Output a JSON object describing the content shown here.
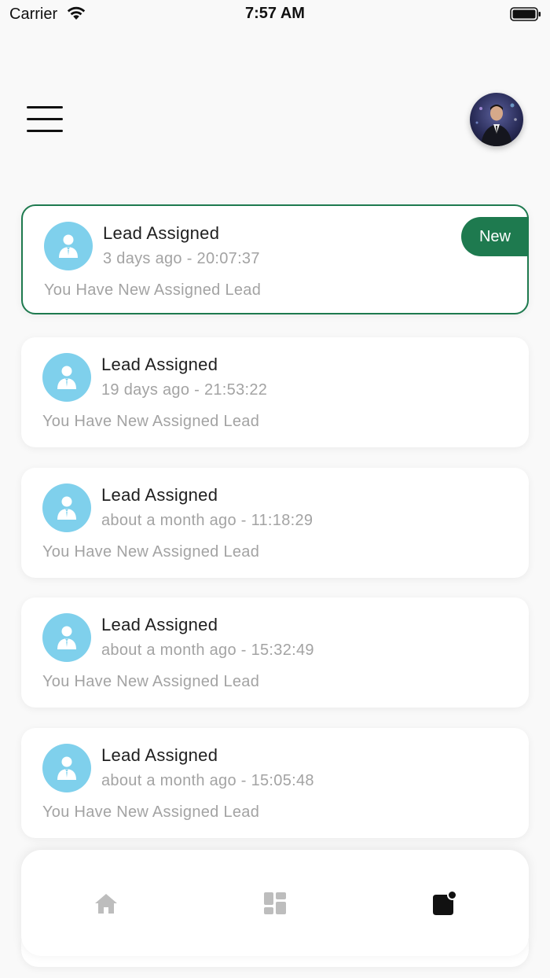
{
  "status_bar": {
    "carrier": "Carrier",
    "time": "7:57 AM"
  },
  "header": {
    "menu_icon": "hamburger-menu-icon",
    "avatar": "user-avatar"
  },
  "notifications": [
    {
      "title": "Lead Assigned",
      "time": "3 days ago - 20:07:37",
      "message": "You Have New Assigned Lead",
      "badge": "New",
      "unread": true,
      "icon": "user-tie-icon"
    },
    {
      "title": "Lead Assigned",
      "time": "19 days ago - 21:53:22",
      "message": "You Have New Assigned Lead",
      "unread": false,
      "icon": "user-tie-icon"
    },
    {
      "title": "Lead Assigned",
      "time": "about a month ago - 11:18:29",
      "message": "You Have New Assigned Lead",
      "unread": false,
      "icon": "user-tie-icon"
    },
    {
      "title": "Lead Assigned",
      "time": "about a month ago - 15:32:49",
      "message": "You Have New Assigned Lead",
      "unread": false,
      "icon": "user-tie-icon"
    },
    {
      "title": "Lead Assigned",
      "time": "about a month ago - 15:05:48",
      "message": "You Have New Assigned Lead",
      "unread": false,
      "icon": "user-tie-icon"
    }
  ],
  "bottom_nav": {
    "items": [
      {
        "icon": "home-icon",
        "active": false
      },
      {
        "icon": "dashboard-icon",
        "active": false
      },
      {
        "icon": "notification-icon",
        "active": true
      }
    ]
  },
  "colors": {
    "accent": "#1e7a4f",
    "icon_bg": "#7fd0ec",
    "muted_text": "#a3a3a3",
    "inactive_nav": "#bdbdbd",
    "active_nav": "#111111"
  }
}
